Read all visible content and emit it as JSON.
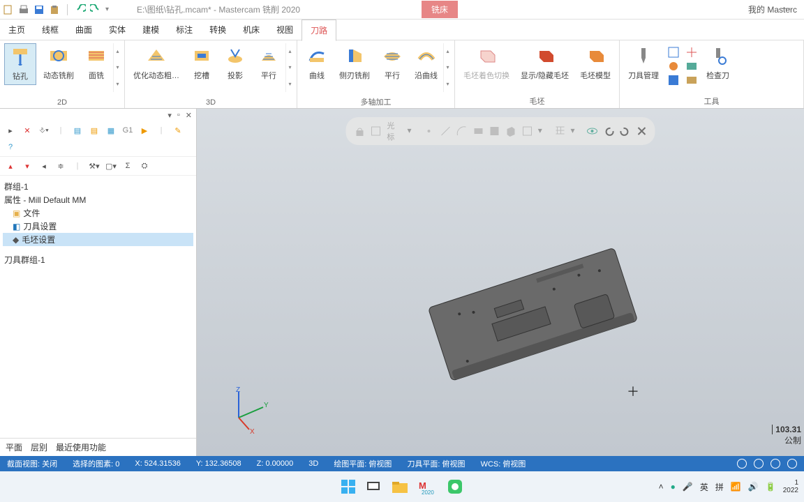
{
  "title": "E:\\图纸\\钻孔.mcam* - Mastercam 铣削 2020",
  "context_tab": "铣床",
  "right_title": "我的 Masterc",
  "winmin": "—",
  "menu": [
    "主页",
    "线框",
    "曲面",
    "实体",
    "建模",
    "标注",
    "转换",
    "机床",
    "视图",
    "刀路"
  ],
  "menu_active": 9,
  "ribbon": {
    "g2d": {
      "label": "2D",
      "items": [
        {
          "name": "钻孔",
          "sel": true
        },
        {
          "name": "动态铣削"
        },
        {
          "name": "面铣"
        }
      ]
    },
    "g3d": {
      "label": "3D",
      "items": [
        {
          "name": "优化动态粗…"
        },
        {
          "name": "挖槽"
        },
        {
          "name": "投影"
        },
        {
          "name": "平行"
        }
      ]
    },
    "gmulti": {
      "label": "多轴加工",
      "items": [
        {
          "name": "曲线"
        },
        {
          "name": "侧刃铣削"
        },
        {
          "name": "平行"
        },
        {
          "name": "沿曲线"
        }
      ]
    },
    "gmao": {
      "label": "毛坯",
      "items": [
        {
          "name": "毛坯着色切换",
          "gray": true
        },
        {
          "name": "显示/隐藏毛坯"
        },
        {
          "name": "毛坯模型"
        }
      ]
    },
    "gtool": {
      "label": "工具",
      "items": [
        {
          "name": "刀具管理"
        },
        {
          "name": "检查刀"
        }
      ]
    }
  },
  "panel_head": [
    "▾",
    "▫",
    "✕"
  ],
  "tree": [
    {
      "t": "群组-1"
    },
    {
      "t": "属性 - Mill Default MM"
    },
    {
      "t": "文件",
      "icon": "folder",
      "indent": 1
    },
    {
      "t": "刀具设置",
      "icon": "tool",
      "indent": 1
    },
    {
      "t": "毛坯设置",
      "icon": "stock",
      "indent": 1,
      "sel": true
    },
    {
      "t": "刀具群组-1"
    }
  ],
  "bottom_tabs": [
    "平面",
    "层别",
    "最近使用功能"
  ],
  "float_label": "光标",
  "status": {
    "s1": "截面视图: 关闭",
    "s2": "选择的图素: 0",
    "x": "X:    524.31536",
    "y": "Y:    132.36508",
    "z": "Z:    0.00000",
    "mode": "3D",
    "p1": "绘图平面: 俯视图",
    "p2": "刀具平面: 俯视图",
    "p3": "WCS: 俯视图"
  },
  "scale": {
    "v": "103.31",
    "u": "公制"
  },
  "tray": {
    "ime1": "英",
    "ime2": "拼",
    "date": "1\n2022"
  },
  "G1": "G1"
}
